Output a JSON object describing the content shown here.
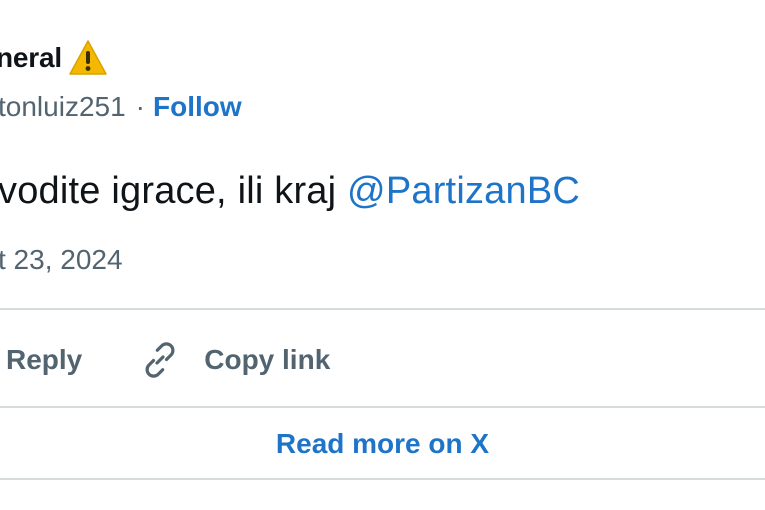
{
  "author": {
    "display_name": "neral",
    "badge_icon": "warning-icon",
    "handle": "tonluiz251",
    "separator": "·",
    "follow_label": "Follow"
  },
  "tweet": {
    "text": "vodite igrace, ili kraj ",
    "mention": "@PartizanBC",
    "timestamp": "t 23, 2024"
  },
  "actions": {
    "reply_label": "Reply",
    "copy_link_label": "Copy link",
    "link_icon": "link-icon"
  },
  "footer": {
    "read_more_label": "Read more on X"
  },
  "colors": {
    "accent": "#1d74c8",
    "secondary_text": "#536471",
    "primary_text": "#0f1419",
    "divider": "#d6dbde",
    "warning": "#f5b800"
  }
}
